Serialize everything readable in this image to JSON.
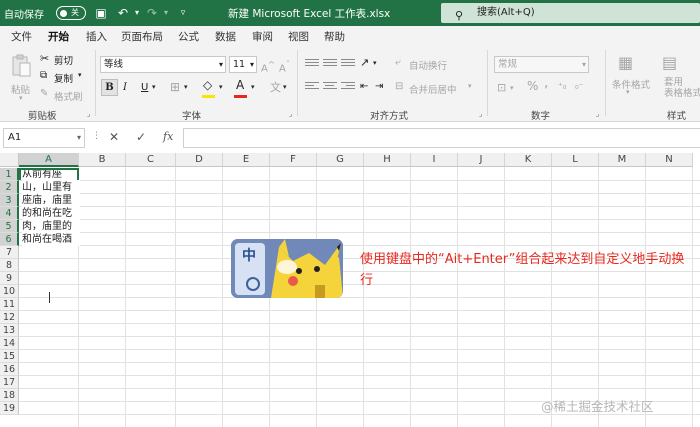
{
  "titlebar": {
    "autosave_label": "自动保存",
    "autosave_state": "关",
    "document_title": "新建 Microsoft Excel 工作表.xlsx",
    "search_placeholder": "搜索(Alt+Q)"
  },
  "menu_tabs": [
    "文件",
    "开始",
    "插入",
    "页面布局",
    "公式",
    "数据",
    "审阅",
    "视图",
    "帮助"
  ],
  "active_tab": "开始",
  "ribbon": {
    "clipboard": {
      "paste": "粘贴",
      "cut": "剪切",
      "copy": "复制",
      "format_painter": "格式刷",
      "group": "剪贴板"
    },
    "font": {
      "font_name": "等线",
      "font_size": "11",
      "bold": "B",
      "italic": "I",
      "underline": "U",
      "group": "字体"
    },
    "alignment": {
      "wrap_text": "自动换行",
      "merge_center": "合并后居中",
      "group": "对齐方式"
    },
    "number": {
      "format": "常规",
      "group": "数字"
    },
    "styles": {
      "conditional": "条件格式",
      "table_format": "套用\n表格格式",
      "group": "样式"
    }
  },
  "formula_bar": {
    "name_box": "A1",
    "fx": "fx",
    "value": ""
  },
  "grid": {
    "columns": [
      "A",
      "B",
      "C",
      "D",
      "E",
      "F",
      "G",
      "H",
      "I",
      "J",
      "K",
      "L",
      "M",
      "N"
    ],
    "rows": [
      "1",
      "2",
      "3",
      "4",
      "5",
      "6",
      "7",
      "8",
      "9",
      "10",
      "11",
      "12",
      "13",
      "14",
      "15",
      "16",
      "17",
      "18",
      "19"
    ],
    "cell_A1_lines": [
      "从前有座",
      "山，山里有",
      "座庙，庙里",
      "的和尚在吃",
      "肉，庙里的",
      "和尚在喝酒"
    ]
  },
  "overlay": {
    "annotation": "使用键盘中的“Ait+Enter”组合起来达到自定义地手动换行",
    "thumb_badge": "中"
  },
  "watermark": "@稀土掘金技术社区",
  "colors": {
    "excel_green": "#217346",
    "annotation_red": "#e8281e"
  }
}
